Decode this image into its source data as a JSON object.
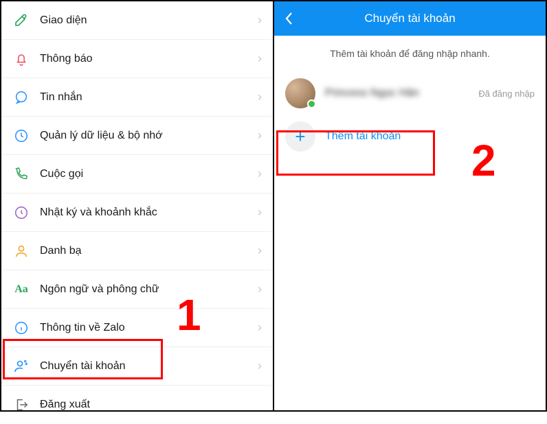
{
  "left": {
    "items": [
      {
        "label": "Giao diện"
      },
      {
        "label": "Thông báo"
      },
      {
        "label": "Tin nhắn"
      },
      {
        "label": "Quản lý dữ liệu & bộ nhớ"
      },
      {
        "label": "Cuộc gọi"
      },
      {
        "label": "Nhật ký và khoảnh khắc"
      },
      {
        "label": "Danh bạ"
      },
      {
        "label": "Ngôn ngữ và phông chữ"
      },
      {
        "label": "Thông tin về Zalo"
      },
      {
        "label": "Chuyển tài khoản"
      },
      {
        "label": "Đăng xuất"
      }
    ]
  },
  "right": {
    "header_title": "Chuyển tài khoản",
    "hint": "Thêm tài khoản để đăng nhập nhanh.",
    "account": {
      "name": "Princess Ngọc Hân",
      "status": "Đã đăng nhập"
    },
    "add_label": "Thêm tài khoản"
  },
  "annotations": {
    "step1": "1",
    "step2": "2"
  }
}
